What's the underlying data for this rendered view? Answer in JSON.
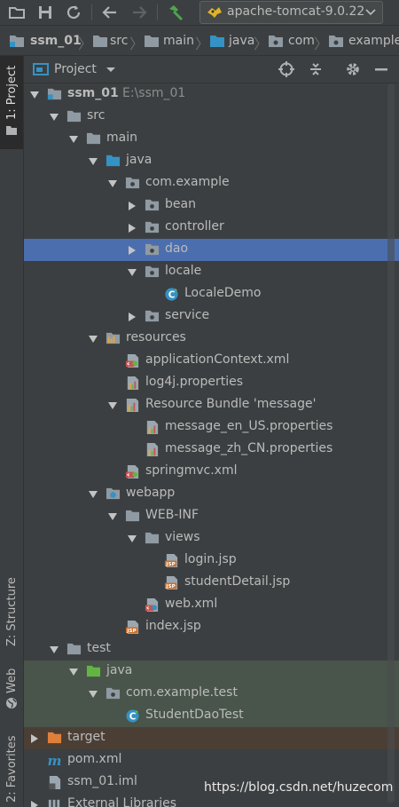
{
  "toolbar": {
    "run_config_label": "apache-tomcat-9.0.22",
    "icons": [
      "open-folder-icon",
      "save-icon",
      "sync-icon",
      "back-icon",
      "forward-icon",
      "build-hammer-icon",
      "tomcat-icon",
      "dropdown-arrow-icon"
    ]
  },
  "breadcrumb": [
    "ssm_01",
    "src",
    "main",
    "java",
    "com",
    "example"
  ],
  "side_tabs": {
    "project": "1: Project",
    "structure": "Z: Structure",
    "web": "Web",
    "favorites": "2: Favorites"
  },
  "panel": {
    "title": "Project"
  },
  "tree": [
    {
      "label": "ssm_01",
      "extra": "E:\\ssm_01",
      "icon": "module-folder-icon",
      "arrow": "down",
      "bold": true
    },
    {
      "label": "src",
      "icon": "folder-icon",
      "arrow": "down"
    },
    {
      "label": "main",
      "icon": "folder-icon",
      "arrow": "down"
    },
    {
      "label": "java",
      "icon": "source-folder-icon",
      "arrow": "down"
    },
    {
      "label": "com.example",
      "icon": "package-icon",
      "arrow": "down"
    },
    {
      "label": "bean",
      "icon": "package-icon",
      "arrow": "right"
    },
    {
      "label": "controller",
      "icon": "package-icon",
      "arrow": "right"
    },
    {
      "label": "dao",
      "icon": "package-icon",
      "arrow": "right",
      "selected": true
    },
    {
      "label": "locale",
      "icon": "package-icon",
      "arrow": "down"
    },
    {
      "label": "LocaleDemo",
      "icon": "java-class-icon"
    },
    {
      "label": "service",
      "icon": "package-icon",
      "arrow": "right"
    },
    {
      "label": "resources",
      "icon": "resources-folder-icon",
      "arrow": "down"
    },
    {
      "label": "applicationContext.xml",
      "icon": "spring-xml-icon"
    },
    {
      "label": "log4j.properties",
      "icon": "properties-icon"
    },
    {
      "label": "Resource Bundle 'message'",
      "icon": "resource-bundle-icon",
      "arrow": "down"
    },
    {
      "label": "message_en_US.properties",
      "icon": "properties-icon"
    },
    {
      "label": "message_zh_CN.properties",
      "icon": "properties-icon"
    },
    {
      "label": "springmvc.xml",
      "icon": "spring-xml-icon"
    },
    {
      "label": "webapp",
      "icon": "web-folder-icon",
      "arrow": "down"
    },
    {
      "label": "WEB-INF",
      "icon": "folder-icon",
      "arrow": "down"
    },
    {
      "label": "views",
      "icon": "folder-icon",
      "arrow": "down"
    },
    {
      "label": "login.jsp",
      "icon": "jsp-icon"
    },
    {
      "label": "studentDetail.jsp",
      "icon": "jsp-icon"
    },
    {
      "label": "web.xml",
      "icon": "web-xml-icon"
    },
    {
      "label": "index.jsp",
      "icon": "jsp-icon"
    },
    {
      "label": "test",
      "icon": "folder-icon",
      "arrow": "down"
    },
    {
      "label": "java",
      "icon": "test-source-folder-icon",
      "arrow": "down",
      "test": true
    },
    {
      "label": "com.example.test",
      "icon": "package-icon",
      "arrow": "down",
      "test": true
    },
    {
      "label": "StudentDaoTest",
      "icon": "java-class-icon",
      "test": true
    },
    {
      "label": "target",
      "icon": "excluded-folder-icon",
      "arrow": "right",
      "excluded": true
    },
    {
      "label": "pom.xml",
      "icon": "maven-icon"
    },
    {
      "label": "ssm_01.iml",
      "icon": "iml-file-icon"
    },
    {
      "label": "External Libraries",
      "icon": "library-icon",
      "arrow": "right"
    }
  ],
  "watermark": "https://blog.csdn.net/huzecom",
  "colors": {
    "background": "#3c3f41",
    "selection": "#4b6eaf",
    "test_background": "#49544a",
    "excluded_background": "#4b3f35",
    "text": "#bbbbbb"
  }
}
